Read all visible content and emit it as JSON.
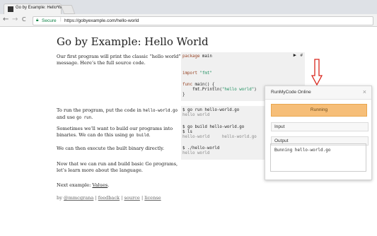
{
  "browser": {
    "tab_title": "Go by Example: Hello W",
    "tab_close": "×",
    "secure_label": "Secure",
    "url": "https://gobyexample.com/hello-world",
    "back": "←",
    "forward": "→",
    "reload": "C"
  },
  "page": {
    "title": "Go by Example: Hello World",
    "intro": "Our first program will print the classic “hello world” message. Here’s the full source code.",
    "run_text_1": "To run the program, put the code in ",
    "run_code_1": "hello-world.go",
    "run_text_2": " and use ",
    "run_code_2": "go run",
    "run_text_3": ".",
    "build_text_1": "Sometimes we’ll want to build our programs into binaries. We can do this using ",
    "build_code": "go build",
    "build_text_2": ".",
    "exec_text": "We can then execute the built binary directly.",
    "learn_text": "Now that we can run and build basic Go programs, let’s learn more about the language.",
    "next_label": "Next example: ",
    "next_link": "Values",
    "next_end": "."
  },
  "code": {
    "pkg_kw": "package",
    "pkg_name": " main",
    "import_kw": "import",
    "import_pkg": " \"fmt\"",
    "func_kw": "func",
    "func_sig": " main() {",
    "println_call": "    fmt.Println(",
    "println_arg": "\"hello world\"",
    "println_end": ")",
    "close_brace": "}",
    "hash": "#",
    "run_icon": "▶"
  },
  "terminal": {
    "cmd1": "$ go run hello-world.go",
    "out1": "hello world",
    "cmd2": "$ go build hello-world.go",
    "cmd3": "$ ls",
    "ls_out": "hello-world     hello-world.go",
    "cmd4": "$ ./hello-world",
    "out4": "hello world"
  },
  "panel": {
    "title": "RunMyCode Online",
    "close": "×",
    "running_label": "Running",
    "input_label": "Input",
    "output_label": "Output",
    "output_text": "Running hello-world.go"
  },
  "footer": {
    "by": "by ",
    "author": "@mmcgrana",
    "sep": " | ",
    "feedback": "feedback",
    "source": "source",
    "license": "license"
  },
  "colors": {
    "running_bg": "#f6be78",
    "arrow": "#d9261c",
    "keyword": "#954121",
    "string": "#219161"
  }
}
